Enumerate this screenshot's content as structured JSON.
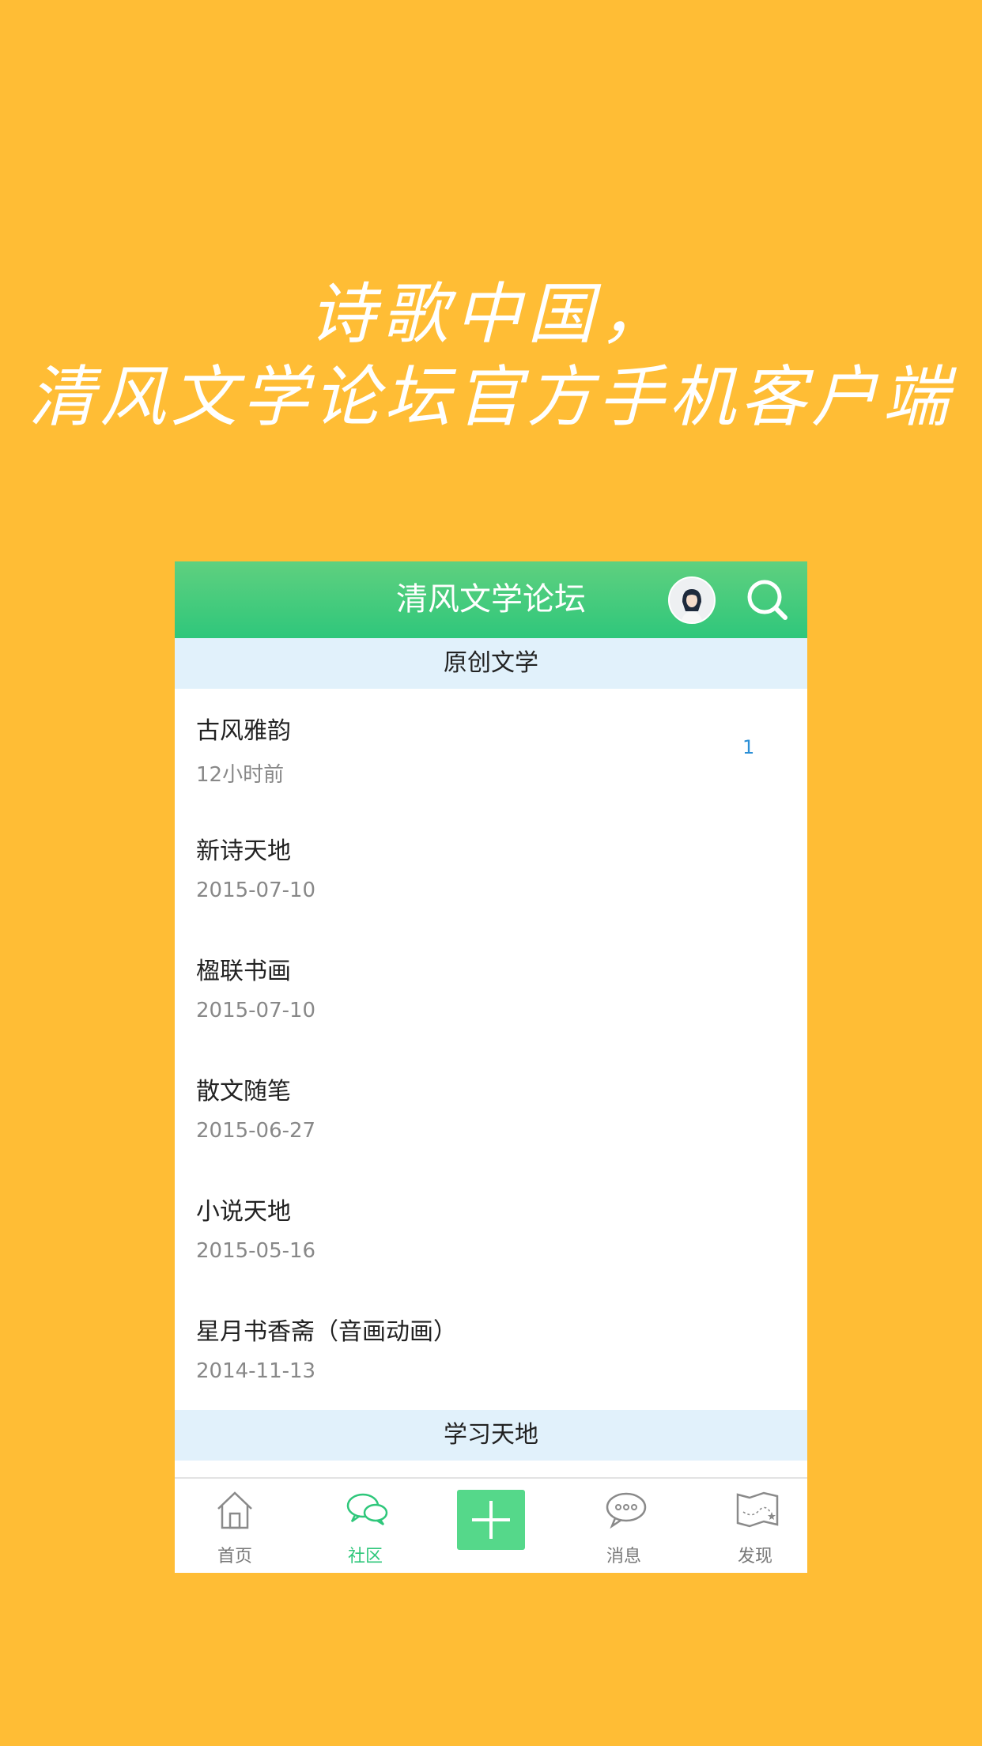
{
  "promo": {
    "line1": "诗歌中国，",
    "line2": "清风文学论坛官方手机客户端"
  },
  "colors": {
    "background": "#ffbd35",
    "accent": "#2fc77b",
    "section_bg": "#e1f1fb"
  },
  "header": {
    "title": "清风文学论坛",
    "avatar_icon": "user-avatar",
    "search_icon": "search-icon"
  },
  "sections": [
    {
      "title": "原创文学",
      "forums": [
        {
          "name": "古风雅韵",
          "time": "12小时前",
          "badge": "1"
        },
        {
          "name": "新诗天地",
          "time": "2015-07-10"
        },
        {
          "name": "楹联书画",
          "time": "2015-07-10"
        },
        {
          "name": "散文随笔",
          "time": "2015-06-27"
        },
        {
          "name": "小说天地",
          "time": "2015-05-16"
        },
        {
          "name": "星月书香斋（音画动画）",
          "time": "2014-11-13"
        }
      ]
    },
    {
      "title": "学习天地",
      "forums": []
    }
  ],
  "tabbar": {
    "items": [
      {
        "label": "首页",
        "icon": "home-icon"
      },
      {
        "label": "社区",
        "icon": "chat-bubbles-icon",
        "active": true
      },
      {
        "label": "",
        "icon": "plus-icon"
      },
      {
        "label": "消息",
        "icon": "message-icon"
      },
      {
        "label": "发现",
        "icon": "map-icon"
      }
    ]
  }
}
